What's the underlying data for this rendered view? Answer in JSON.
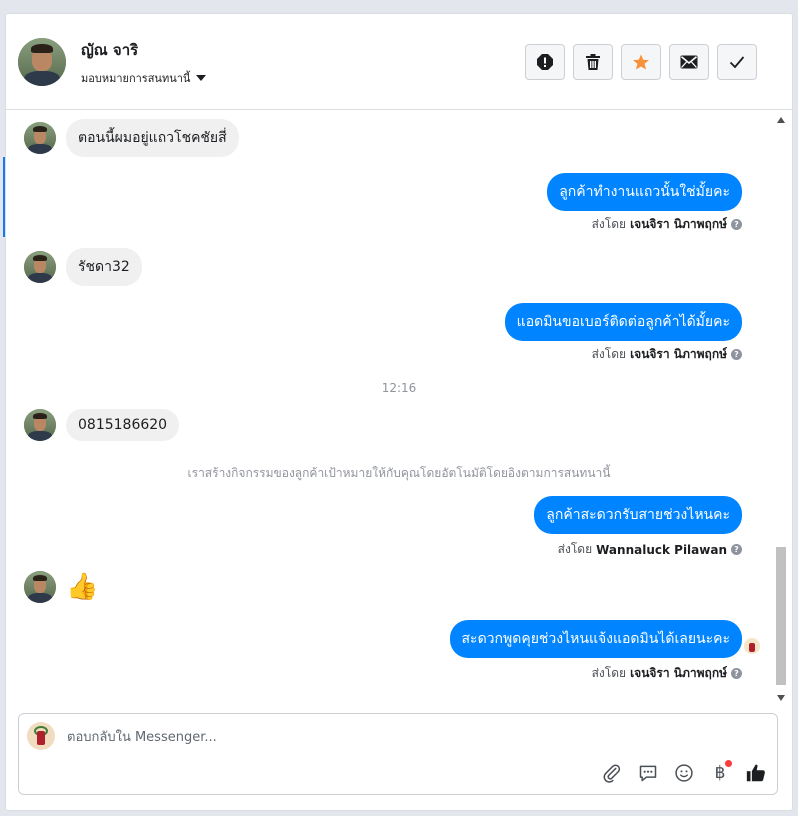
{
  "header": {
    "contact_name": "ญัณ จาริ",
    "assign_label": "มอบหมายการสนทนานี้"
  },
  "actions": [
    {
      "name": "mark-spam-button",
      "icon": "exclamation-icon"
    },
    {
      "name": "delete-button",
      "icon": "trash-icon"
    },
    {
      "name": "star-button",
      "icon": "star-icon",
      "color": "#f7923a"
    },
    {
      "name": "mark-unread-button",
      "icon": "envelope-icon"
    },
    {
      "name": "mark-done-button",
      "icon": "check-icon"
    }
  ],
  "messages": {
    "m1": "ตอนนี้ผมอยู่แถวโชคชัยสี่",
    "m2": "ลูกค้าทำงานแถวนั้นใช่มั้ยคะ",
    "m2_sent_prefix": "ส่งโดย",
    "m2_sender": "เจนจิรา นิภาพฤกษ์",
    "m3": "รัชดา32",
    "m4": "แอดมินขอเบอร์ติดต่อลูกค้าได้มั้ยคะ",
    "m4_sent_prefix": "ส่งโดย",
    "m4_sender": "เจนจิรา นิภาพฤกษ์",
    "time": "12:16",
    "m5": "0815186620",
    "system_note": "เราสร้างกิจกรรมของลูกค้าเป้าหมายให้กับคุณโดยอัตโนมัติโดยอิงตามการสนทนานี้",
    "m6": "ลูกค้าสะดวกรับสายช่วงไหนคะ",
    "m6_sent_prefix": "ส่งโดย",
    "m6_sender": "Wannaluck Pilawan",
    "m7": "👍",
    "m8": "สะดวกพูดคุยช่วงไหนแจ้งแอดมินได้เลยนะคะ",
    "m8_sent_prefix": "ส่งโดย",
    "m8_sender": "เจนจิรา นิภาพฤกษ์"
  },
  "composer": {
    "placeholder": "ตอบกลับใน Messenger..."
  },
  "tools": [
    {
      "name": "attach-icon"
    },
    {
      "name": "saved-replies-icon"
    },
    {
      "name": "emoji-icon"
    },
    {
      "name": "payment-icon",
      "label": "฿"
    },
    {
      "name": "like-icon"
    }
  ],
  "colors": {
    "outgoing_bubble": "#0084ff",
    "incoming_bubble": "#f0f0f0",
    "star": "#f7923a",
    "notification_dot": "#fa3e3e"
  }
}
